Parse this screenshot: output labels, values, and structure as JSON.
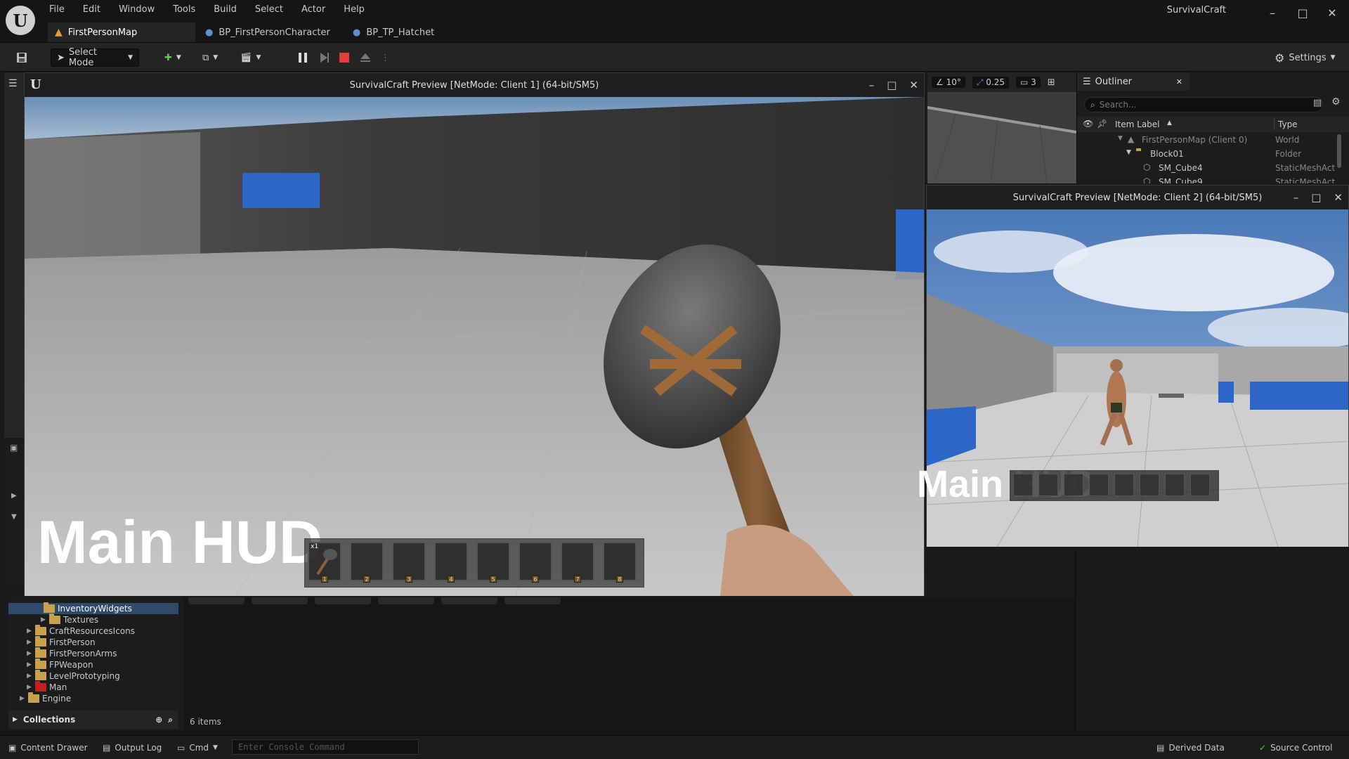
{
  "app": {
    "title": "SurvivalCraft",
    "logo": "U",
    "menu": [
      "File",
      "Edit",
      "Window",
      "Tools",
      "Build",
      "Select",
      "Actor",
      "Help"
    ],
    "tabs": [
      {
        "label": "FirstPersonMap",
        "icon": "map-icon",
        "active": true
      },
      {
        "label": "BP_FirstPersonCharacter",
        "icon": "blueprint-icon",
        "active": false
      },
      {
        "label": "BP_TP_Hatchet",
        "icon": "blueprint-icon",
        "active": false
      }
    ],
    "window_controls": {
      "minimize": "–",
      "maximize": "□",
      "close": "✕"
    }
  },
  "toolbar": {
    "select_mode": "Select Mode",
    "settings": "Settings"
  },
  "viewport_controls": {
    "angle_snap": "10°",
    "scale_snap": "0.25",
    "camera_speed": "3"
  },
  "outliner": {
    "tab_label": "Outliner",
    "search_placeholder": "Search...",
    "col_item_label": "Item Label",
    "col_type": "Type",
    "rows": [
      {
        "label": "FirstPersonMap (Client 0)",
        "type": "World"
      },
      {
        "label": "Block01",
        "type": "Folder"
      },
      {
        "label": "SM_Cube4",
        "type": "StaticMeshAct"
      },
      {
        "label": "SM_Cube9",
        "type": "StaticMeshAct"
      }
    ]
  },
  "pie1": {
    "title": "SurvivalCraft Preview [NetMode: Client 1]  (64-bit/SM5)",
    "hud_text": "Main HUD",
    "first_slot_count": "x1",
    "slots": [
      "1",
      "2",
      "3",
      "4",
      "5",
      "6",
      "7",
      "8"
    ]
  },
  "pie2": {
    "title": "SurvivalCraft Preview [NetMode: Client 2]  (64-bit/SM5)",
    "hud_text": "Main HUD"
  },
  "content_browser": {
    "folders": [
      {
        "label": "InventoryWidgets",
        "selected": true,
        "indent": 2
      },
      {
        "label": "Textures",
        "indent": 2
      },
      {
        "label": "CraftResourcesIcons",
        "indent": 1
      },
      {
        "label": "FirstPerson",
        "indent": 1
      },
      {
        "label": "FirstPersonArms",
        "indent": 1
      },
      {
        "label": "FPWeapon",
        "indent": 1
      },
      {
        "label": "LevelPrototyping",
        "indent": 1
      },
      {
        "label": "Man",
        "indent": 1,
        "red": true
      },
      {
        "label": "Engine",
        "indent": 0
      }
    ],
    "collections": "Collections",
    "item_count": "6 items"
  },
  "bottom": {
    "content_drawer": "Content Drawer",
    "output_log": "Output Log",
    "cmd": "Cmd",
    "console_placeholder": "Enter Console Command",
    "derived_data": "Derived Data",
    "source_control": "Source Control"
  }
}
